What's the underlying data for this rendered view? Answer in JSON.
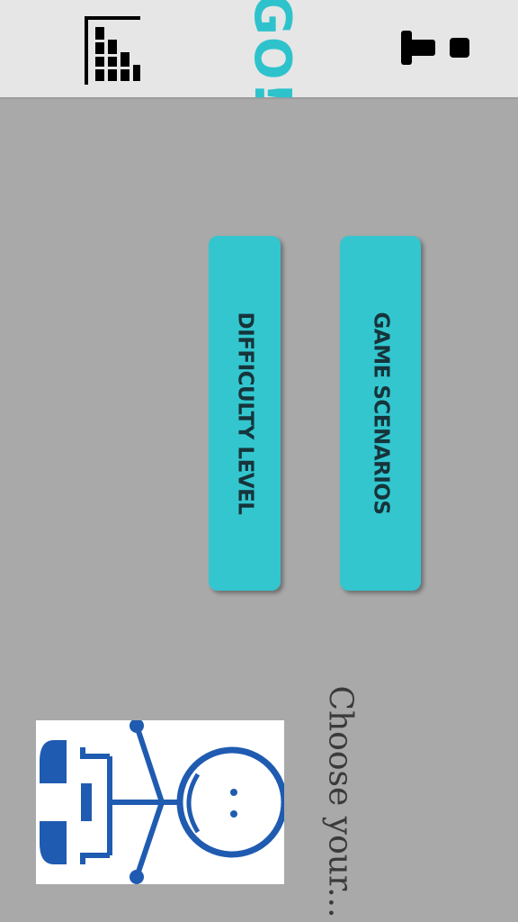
{
  "header": {
    "logo_text": "GO!",
    "menu_icon": "leaderboard-bars-icon",
    "user_icon": "rotated-person-icon",
    "accent_color": "#2ec3cc"
  },
  "menu": {
    "difficulty_label": "DIFFICULTY LEVEL",
    "scenarios_label": "GAME SCENARIOS",
    "button_color": "#33c6cf"
  },
  "character": {
    "icon": "smiley-stick-figure-icon",
    "prompt": "Choose your..."
  }
}
